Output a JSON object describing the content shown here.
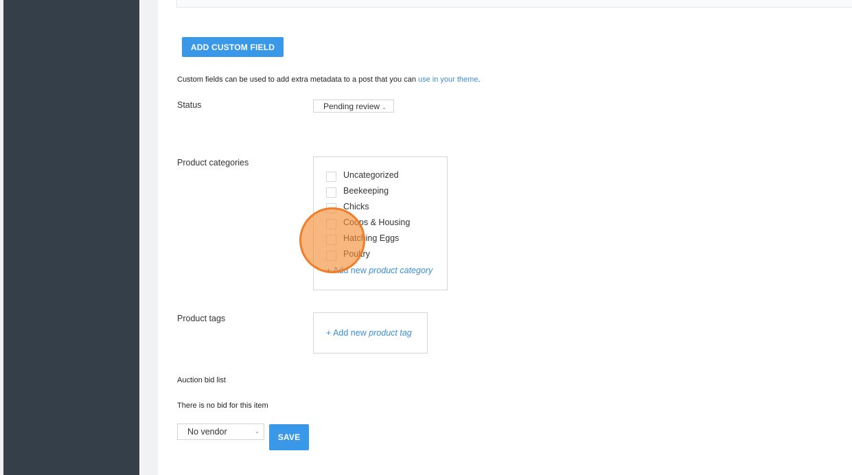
{
  "buttons": {
    "add_custom_field": "ADD CUSTOM FIELD",
    "save": "SAVE"
  },
  "custom_fields": {
    "description_prefix": "Custom fields can be used to add extra metadata to a post that you can ",
    "description_link": "use in your theme",
    "description_suffix": "."
  },
  "status": {
    "label": "Status",
    "selected": "Pending review"
  },
  "categories": {
    "label": "Product categories",
    "items": [
      {
        "label": "Uncategorized",
        "checked": false
      },
      {
        "label": "Beekeeping",
        "checked": false
      },
      {
        "label": "Chicks",
        "checked": false
      },
      {
        "label": "Coops & Housing",
        "checked": false
      },
      {
        "label": "Hatching Eggs",
        "checked": false
      },
      {
        "label": "Poultry",
        "checked": false
      }
    ],
    "add_prefix": "+ Add new ",
    "add_emphasis": "product category"
  },
  "tags": {
    "label": "Product tags",
    "add_prefix": "+ Add new ",
    "add_emphasis": "product tag"
  },
  "auction": {
    "title": "Auction bid list",
    "empty_message": "There is no bid for this item"
  },
  "vendor": {
    "selected": "No vendor"
  },
  "colors": {
    "sidebar": "#343f4a",
    "accent": "#3a98e8",
    "link": "#3a8fd6",
    "cursor_highlight": "#f58a32"
  },
  "icons": {
    "dropdown": "chevron-down-icon"
  }
}
